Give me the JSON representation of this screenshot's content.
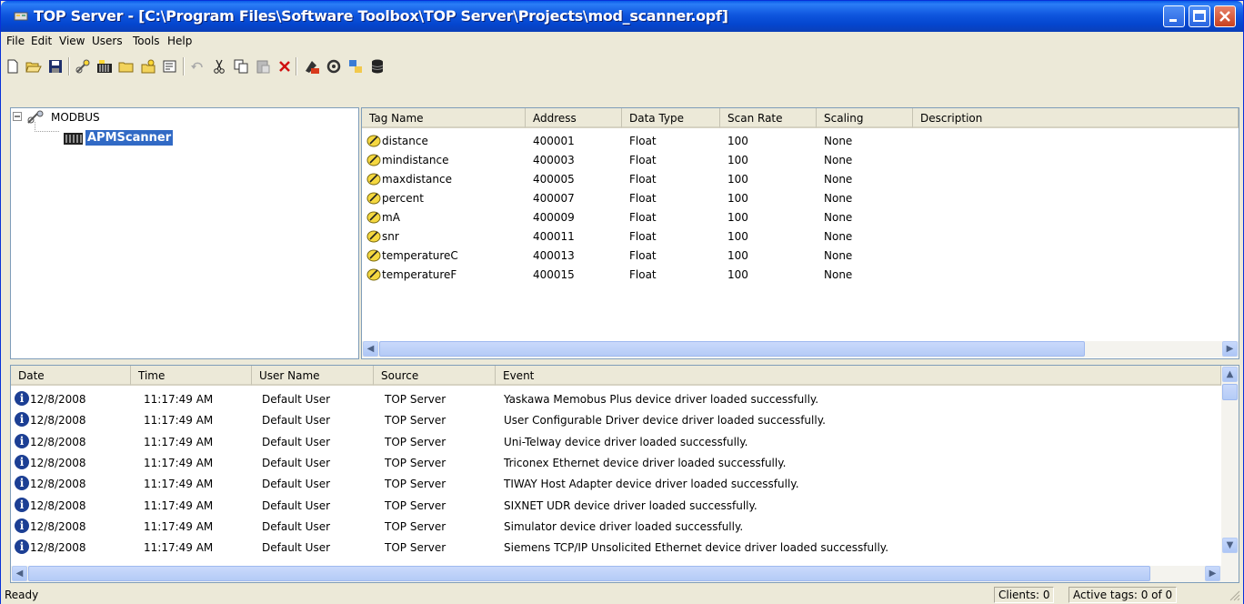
{
  "window": {
    "title": "TOP Server - [C:\\Program Files\\Software Toolbox\\TOP Server\\Projects\\mod_scanner.opf]"
  },
  "menu": [
    "File",
    "Edit",
    "View",
    "Users",
    "Tools",
    "Help"
  ],
  "toolbar_icons": [
    "new-icon",
    "open-icon",
    "save-icon",
    "new-channel-icon",
    "new-device-icon",
    "new-tag-group-icon",
    "new-tag-icon",
    "properties-icon",
    "undo-icon",
    "cut-icon",
    "copy-icon",
    "paste-icon",
    "delete-icon",
    "quick-client-icon",
    "runtime-connect-icon",
    "runtime-disconnect-icon",
    "database-icon"
  ],
  "tree": {
    "channel": "MODBUS",
    "device": "APMScanner"
  },
  "tags": {
    "columns": [
      "Tag Name",
      "Address",
      "Data Type",
      "Scan Rate",
      "Scaling",
      "Description"
    ],
    "rows": [
      {
        "name": "distance",
        "address": "400001",
        "type": "Float",
        "rate": "100",
        "scaling": "None"
      },
      {
        "name": "mindistance",
        "address": "400003",
        "type": "Float",
        "rate": "100",
        "scaling": "None"
      },
      {
        "name": "maxdistance",
        "address": "400005",
        "type": "Float",
        "rate": "100",
        "scaling": "None"
      },
      {
        "name": "percent",
        "address": "400007",
        "type": "Float",
        "rate": "100",
        "scaling": "None"
      },
      {
        "name": "mA",
        "address": "400009",
        "type": "Float",
        "rate": "100",
        "scaling": "None"
      },
      {
        "name": "snr",
        "address": "400011",
        "type": "Float",
        "rate": "100",
        "scaling": "None"
      },
      {
        "name": "temperatureC",
        "address": "400013",
        "type": "Float",
        "rate": "100",
        "scaling": "None"
      },
      {
        "name": "temperatureF",
        "address": "400015",
        "type": "Float",
        "rate": "100",
        "scaling": "None"
      }
    ]
  },
  "events": {
    "columns": [
      "Date",
      "Time",
      "User Name",
      "Source",
      "Event"
    ],
    "rows": [
      {
        "date": "12/8/2008",
        "time": "11:17:49 AM",
        "user": "Default User",
        "source": "TOP Server",
        "event": "Yaskawa Memobus Plus device driver loaded successfully."
      },
      {
        "date": "12/8/2008",
        "time": "11:17:49 AM",
        "user": "Default User",
        "source": "TOP Server",
        "event": "User Configurable Driver device driver loaded successfully."
      },
      {
        "date": "12/8/2008",
        "time": "11:17:49 AM",
        "user": "Default User",
        "source": "TOP Server",
        "event": "Uni-Telway device driver loaded successfully."
      },
      {
        "date": "12/8/2008",
        "time": "11:17:49 AM",
        "user": "Default User",
        "source": "TOP Server",
        "event": "Triconex Ethernet device driver loaded successfully."
      },
      {
        "date": "12/8/2008",
        "time": "11:17:49 AM",
        "user": "Default User",
        "source": "TOP Server",
        "event": "TIWAY Host Adapter device driver loaded successfully."
      },
      {
        "date": "12/8/2008",
        "time": "11:17:49 AM",
        "user": "Default User",
        "source": "TOP Server",
        "event": "SIXNET UDR device driver loaded successfully."
      },
      {
        "date": "12/8/2008",
        "time": "11:17:49 AM",
        "user": "Default User",
        "source": "TOP Server",
        "event": "Simulator device driver loaded successfully."
      },
      {
        "date": "12/8/2008",
        "time": "11:17:49 AM",
        "user": "Default User",
        "source": "TOP Server",
        "event": "Siemens TCP/IP Unsolicited Ethernet device driver loaded successfully."
      }
    ]
  },
  "status": {
    "text": "Ready",
    "clients": "Clients:  0",
    "active_tags": "Active tags:  0 of 0"
  },
  "colors": {
    "title_blue": "#0a5ce8",
    "selection": "#316ac5",
    "xp_face": "#ece9d8"
  }
}
